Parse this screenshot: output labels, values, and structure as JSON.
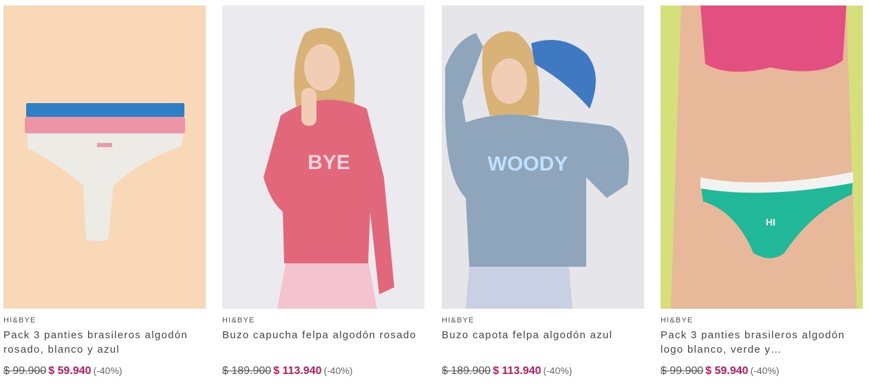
{
  "colors": {
    "price_accent": "#c2185b",
    "card1_bg": "#f9d8b8",
    "card2_bg": "#ebeaee",
    "card3_bg": "#e6e6ea",
    "card4_bg": "#d6e07a"
  },
  "products": [
    {
      "brand": "HI&BYE",
      "title": "Pack 3 panties brasileros algodón rosado, blanco y azul",
      "old_price": "$ 99.900",
      "new_price": "$ 59.940",
      "discount": "(-40%)"
    },
    {
      "brand": "HI&BYE",
      "title": "Buzo capucha felpa algodón rosado",
      "old_price": "$ 189.900",
      "new_price": "$ 113.940",
      "discount": "(-40%)"
    },
    {
      "brand": "HI&BYE",
      "title": "Buzo capota felpa algodón azul",
      "old_price": "$ 189.900",
      "new_price": "$ 113.940",
      "discount": "(-40%)"
    },
    {
      "brand": "HI&BYE",
      "title": "Pack 3 panties brasileros algodón logo blanco, verde y…",
      "old_price": "$ 99.900",
      "new_price": "$ 59.940",
      "discount": "(-40%)"
    }
  ]
}
